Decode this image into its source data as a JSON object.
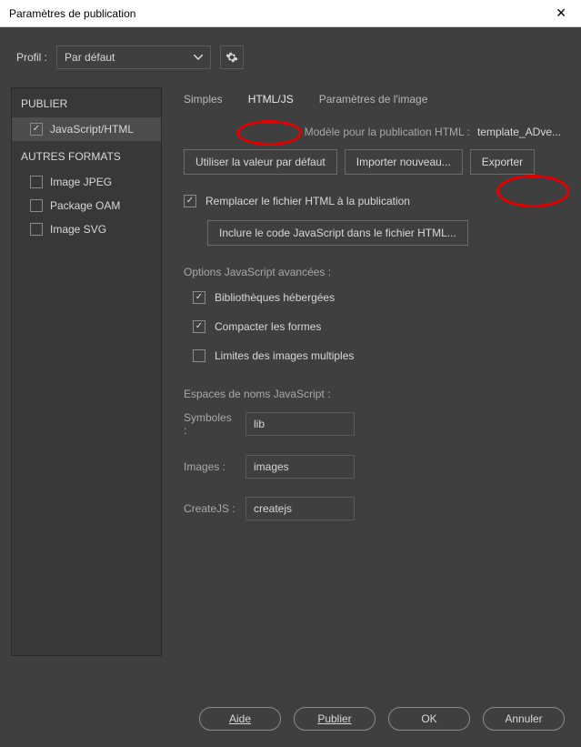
{
  "titlebar": {
    "title": "Paramètres de publication"
  },
  "profile": {
    "label": "Profil :",
    "selected": "Par défaut"
  },
  "sidebar": {
    "publish_header": "PUBLIER",
    "other_header": "AUTRES FORMATS",
    "items": [
      {
        "label": "JavaScript/HTML",
        "checked": true,
        "selected": true
      },
      {
        "label": "Image JPEG",
        "checked": false,
        "selected": false
      },
      {
        "label": "Package OAM",
        "checked": false,
        "selected": false
      },
      {
        "label": "Image SVG",
        "checked": false,
        "selected": false
      }
    ]
  },
  "tabs": {
    "simple": "Simples",
    "htmljs": "HTML/JS",
    "image": "Paramètres de l'image"
  },
  "template": {
    "label": "Modèle pour la publication HTML :",
    "value": "template_ADve..."
  },
  "buttons": {
    "use_default": "Utiliser la valeur par défaut",
    "import_new": "Importer nouveau...",
    "export": "Exporter"
  },
  "replace_check": {
    "label": "Remplacer le fichier HTML à la publication",
    "checked": true
  },
  "include_js_btn": "Inclure le code JavaScript dans le fichier HTML...",
  "advanced_label": "Options JavaScript avancées :",
  "adv_opts": [
    {
      "label": "Bibliothèques hébergées",
      "checked": true
    },
    {
      "label": "Compacter les formes",
      "checked": true
    },
    {
      "label": "Limites des images multiples",
      "checked": false
    }
  ],
  "ns_label": "Espaces de noms JavaScript :",
  "ns_fields": {
    "symbols_label": "Symboles :",
    "symbols_value": "lib",
    "images_label": "Images :",
    "images_value": "images",
    "createjs_label": "CreateJS :",
    "createjs_value": "createjs"
  },
  "footer": {
    "help": "Aide",
    "publish": "Publier",
    "ok": "OK",
    "cancel": "Annuler"
  }
}
